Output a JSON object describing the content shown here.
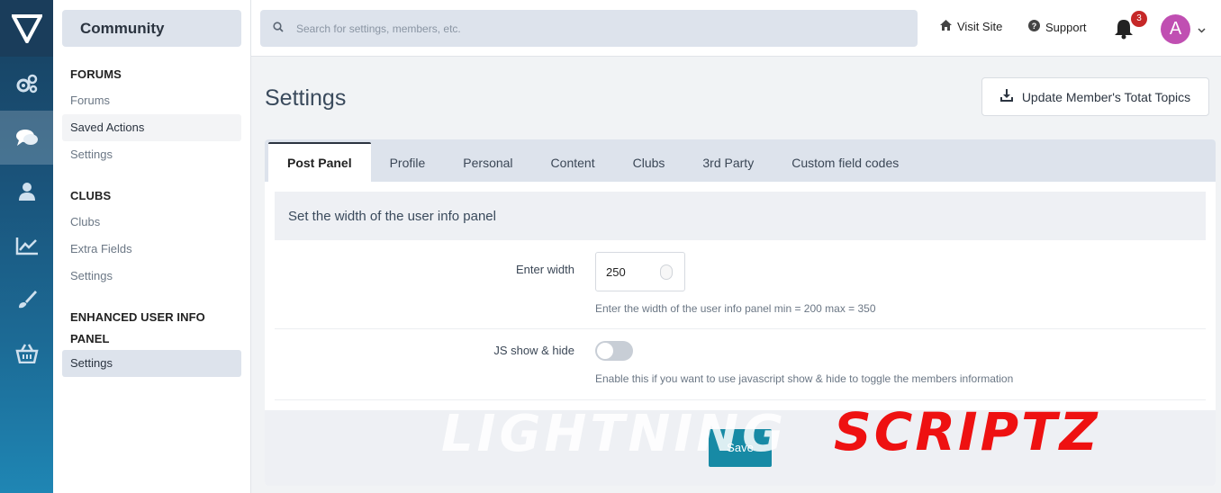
{
  "app": {
    "section_title": "Community"
  },
  "rail": {
    "icons": [
      "logo-icon",
      "gears-icon",
      "chat-icon",
      "user-icon",
      "chart-icon",
      "brush-icon",
      "basket-icon"
    ]
  },
  "sidebar": {
    "forums_heading": "FORUMS",
    "forums_items": [
      "Forums",
      "Saved Actions",
      "Settings"
    ],
    "clubs_heading": "CLUBS",
    "clubs_items": [
      "Clubs",
      "Extra Fields",
      "Settings"
    ],
    "eui_heading_1": "ENHANCED USER INFO",
    "eui_heading_2": "PANEL",
    "eui_items": [
      "Settings"
    ]
  },
  "topbar": {
    "search_placeholder": "Search for settings, members, etc.",
    "visit_site": "Visit Site",
    "support": "Support",
    "notification_count": "3",
    "avatar_letter": "A"
  },
  "main": {
    "title": "Settings",
    "update_button": "Update Member's Totat Topics",
    "tabs": [
      "Post Panel",
      "Profile",
      "Personal",
      "Content",
      "Clubs",
      "3rd Party",
      "Custom field codes"
    ],
    "section_header": "Set the width of the user info panel",
    "width_label": "Enter width",
    "width_value": "250",
    "width_hint": "Enter the width of the user info panel min = 200 max = 350",
    "js_label": "JS show & hide",
    "js_hint": "Enable this if you want to use javascript show & hide to toggle the members information",
    "save_label": "Save"
  },
  "watermark": {
    "text_light": "LIGHTNING",
    "text_red": "SCRIPTZ"
  },
  "colors": {
    "accent": "#178aa5",
    "rail_top": "#17405f",
    "rail_bottom": "#1f86b4",
    "badge": "#c62828",
    "avatar": "#c04fb2"
  }
}
